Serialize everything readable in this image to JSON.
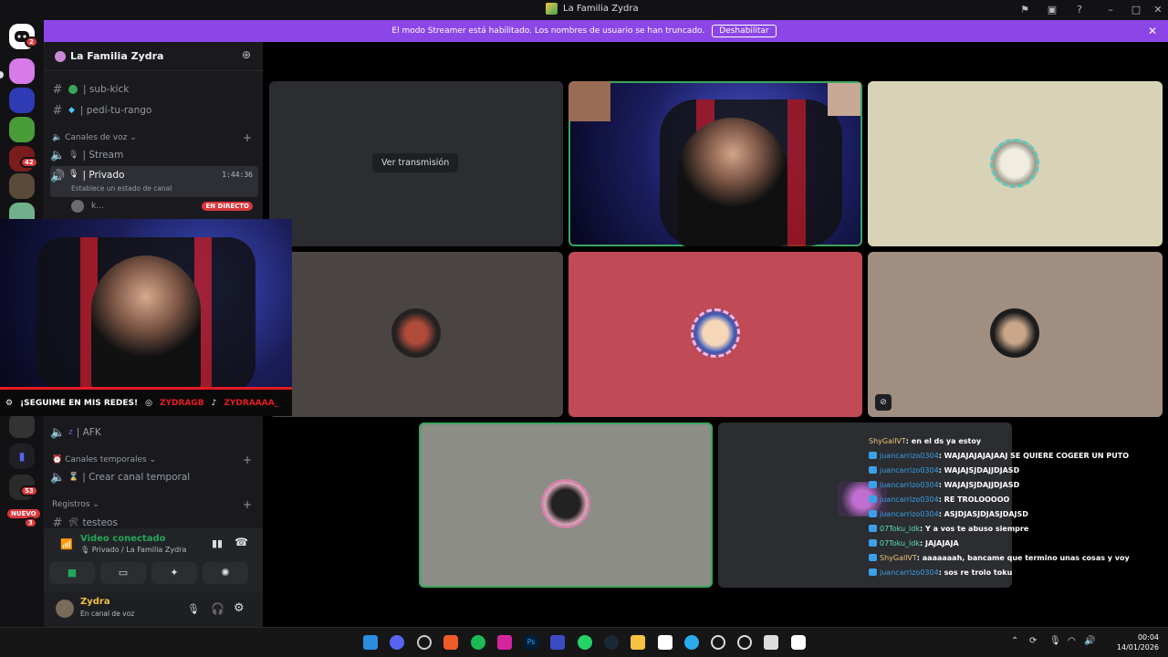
{
  "window": {
    "title": "La Familia Zydra"
  },
  "banner": {
    "text": "El modo Streamer está habilitado. Los nombres de usuario se han truncado.",
    "button": "Deshabilitar"
  },
  "rail": {
    "badges": [
      "2",
      "42",
      "53",
      "3"
    ],
    "new_label": "NUEVO"
  },
  "guild": {
    "name": "La Familia Zydra",
    "channels_text": [
      {
        "name": "| sub-kick"
      },
      {
        "name": "| pedí-tu-rango"
      }
    ],
    "voice_category": "Canales de voz",
    "voice_channels": [
      {
        "name": "| Stream"
      },
      {
        "name": "| Privado",
        "timer": "1:44:36",
        "status_placeholder": "Establece un estado de canal"
      }
    ],
    "live_user": "k...",
    "live_badge": "EN DIRECTO",
    "afk_channel": "| AFK",
    "temp_category": "Canales temporales",
    "temp_channel": "| Crear canal temporal",
    "logs_category": "Registros",
    "logs_channel": "testeos"
  },
  "voice_panel": {
    "status": "Video conectado",
    "location": "Privado / La Familia Zydra",
    "user_name": "Zydra",
    "user_status": "En canal de voz"
  },
  "overlay": {
    "follow_text": "¡SEGUIME EN MIS REDES!",
    "instagram": "ZYDRAGB",
    "tiktok": "ZYDRAAAA_"
  },
  "tiles": {
    "watch_stream": "Ver transmisión"
  },
  "chat": [
    {
      "user": "ShyGallVT",
      "msg": ": en el ds ya estoy",
      "color": "#f0c27a"
    },
    {
      "user": "juancarrizo0304",
      "msg": ": WAJAJAJAJAJAAJ SE QUIERE COGEER UN PUTO",
      "color": "#3aa0e8"
    },
    {
      "user": "juancarrizo0304",
      "msg": ": WAJAJSJDAJJDJASD",
      "color": "#3aa0e8"
    },
    {
      "user": "juancarrizo0304",
      "msg": ": WAJAJSJDAJJDJASD",
      "color": "#3aa0e8"
    },
    {
      "user": "juancarrizo0304",
      "msg": ": RE TROLOOOOO",
      "color": "#3aa0e8"
    },
    {
      "user": "juancarrizo0304",
      "msg": ": ASJDJASJDJASJDAJSD",
      "color": "#3aa0e8"
    },
    {
      "user": "07Toku_ldk",
      "msg": ": Y a vos te abuso siempre",
      "color": "#5ce0a8"
    },
    {
      "user": "07Toku_ldk",
      "msg": ": JAJAJAJA",
      "color": "#5ce0a8"
    },
    {
      "user": "ShyGallVT",
      "msg": ": aaaaaaah, bancame que termino unas cosas y voy",
      "color": "#f0c27a"
    },
    {
      "user": "juancarrizo0304",
      "msg": ": sos re trolo toku",
      "color": "#3aa0e8"
    }
  ],
  "taskbar": {
    "time": "00:04",
    "date": "14/01/2026"
  },
  "colors": {
    "accent": "#8c46e8",
    "online": "#23a55a",
    "live": "#da373c"
  }
}
